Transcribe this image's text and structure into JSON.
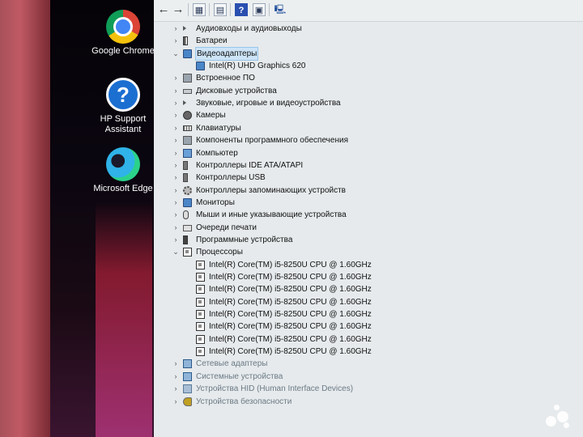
{
  "desktop": {
    "icons": [
      {
        "label": "Google Chrome"
      },
      {
        "label": "HP Support Assistant"
      },
      {
        "label": "Microsoft Edge"
      }
    ]
  },
  "toolbar": {
    "back_glyph": "←",
    "forward_glyph": "→",
    "help_glyph": "?"
  },
  "tree": [
    {
      "label": "Аудиовходы и аудиовыходы",
      "level": 0,
      "expanded": false,
      "icon": "speaker-icon"
    },
    {
      "label": "Батареи",
      "level": 0,
      "expanded": false,
      "icon": "battery-icon"
    },
    {
      "label": "Видеоадаптеры",
      "level": 0,
      "expanded": true,
      "selected": true,
      "icon": "display-adapter-icon"
    },
    {
      "label": "Intel(R) UHD Graphics 620",
      "level": 1,
      "icon": "display-adapter-icon"
    },
    {
      "label": "Встроенное ПО",
      "level": 0,
      "expanded": false,
      "icon": "firmware-icon"
    },
    {
      "label": "Дисковые устройства",
      "level": 0,
      "expanded": false,
      "icon": "disk-icon"
    },
    {
      "label": "Звуковые, игровые и видеоустройства",
      "level": 0,
      "expanded": false,
      "icon": "speaker-icon"
    },
    {
      "label": "Камеры",
      "level": 0,
      "expanded": false,
      "icon": "camera-icon"
    },
    {
      "label": "Клавиатуры",
      "level": 0,
      "expanded": false,
      "icon": "keyboard-icon"
    },
    {
      "label": "Компоненты программного обеспечения",
      "level": 0,
      "expanded": false,
      "icon": "software-component-icon"
    },
    {
      "label": "Компьютер",
      "level": 0,
      "expanded": false,
      "icon": "computer-icon"
    },
    {
      "label": "Контроллеры IDE ATA/ATAPI",
      "level": 0,
      "expanded": false,
      "icon": "ide-controller-icon"
    },
    {
      "label": "Контроллеры USB",
      "level": 0,
      "expanded": false,
      "icon": "usb-icon"
    },
    {
      "label": "Контроллеры запоминающих устройств",
      "level": 0,
      "expanded": false,
      "icon": "storage-controller-icon"
    },
    {
      "label": "Мониторы",
      "level": 0,
      "expanded": false,
      "icon": "monitor-icon"
    },
    {
      "label": "Мыши и иные указывающие устройства",
      "level": 0,
      "expanded": false,
      "icon": "mouse-icon"
    },
    {
      "label": "Очереди печати",
      "level": 0,
      "expanded": false,
      "icon": "printer-icon"
    },
    {
      "label": "Программные устройства",
      "level": 0,
      "expanded": false,
      "icon": "software-device-icon"
    },
    {
      "label": "Процессоры",
      "level": 0,
      "expanded": true,
      "icon": "processor-icon"
    },
    {
      "label": "Intel(R) Core(TM) i5-8250U CPU @ 1.60GHz",
      "level": 1,
      "icon": "processor-icon"
    },
    {
      "label": "Intel(R) Core(TM) i5-8250U CPU @ 1.60GHz",
      "level": 1,
      "icon": "processor-icon"
    },
    {
      "label": "Intel(R) Core(TM) i5-8250U CPU @ 1.60GHz",
      "level": 1,
      "icon": "processor-icon"
    },
    {
      "label": "Intel(R) Core(TM) i5-8250U CPU @ 1.60GHz",
      "level": 1,
      "icon": "processor-icon"
    },
    {
      "label": "Intel(R) Core(TM) i5-8250U CPU @ 1.60GHz",
      "level": 1,
      "icon": "processor-icon"
    },
    {
      "label": "Intel(R) Core(TM) i5-8250U CPU @ 1.60GHz",
      "level": 1,
      "icon": "processor-icon"
    },
    {
      "label": "Intel(R) Core(TM) i5-8250U CPU @ 1.60GHz",
      "level": 1,
      "icon": "processor-icon"
    },
    {
      "label": "Intel(R) Core(TM) i5-8250U CPU @ 1.60GHz",
      "level": 1,
      "icon": "processor-icon"
    },
    {
      "label": "Сетевые адаптеры",
      "level": 0,
      "expanded": false,
      "faded": true,
      "icon": "network-adapter-icon"
    },
    {
      "label": "Системные устройства",
      "level": 0,
      "expanded": false,
      "faded": true,
      "icon": "system-device-icon"
    },
    {
      "label": "Устройства HID (Human Interface Devices)",
      "level": 0,
      "expanded": false,
      "faded": true,
      "icon": "hid-icon"
    },
    {
      "label": "Устройства безопасности",
      "level": 0,
      "expanded": false,
      "faded": true,
      "icon": "security-device-icon"
    }
  ],
  "watermark": {
    "text": "Avito"
  }
}
